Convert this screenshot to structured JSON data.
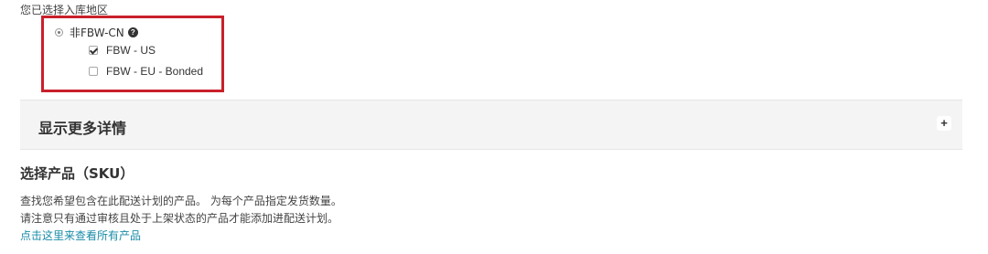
{
  "region": {
    "label": "您已选择入库地区",
    "radio_option": {
      "label": "非FBW-CN",
      "selected": true,
      "help_icon": "?"
    },
    "checkboxes": [
      {
        "label": "FBW - US",
        "checked": true
      },
      {
        "label": "FBW - EU - Bonded",
        "checked": false
      }
    ],
    "highlight_color": "#c9202b"
  },
  "details_panel": {
    "title": "显示更多详情",
    "expand_icon": "+"
  },
  "products": {
    "title": "选择产品（SKU）",
    "description_line1": "查找您希望包含在此配送计划的产品。 为每个产品指定发货数量。",
    "description_line2": "请注意只有通过审核且处于上架状态的产品才能添加进配送计划。",
    "view_all_link": "点击这里来查看所有产品",
    "link_color": "#1a8ca8"
  }
}
